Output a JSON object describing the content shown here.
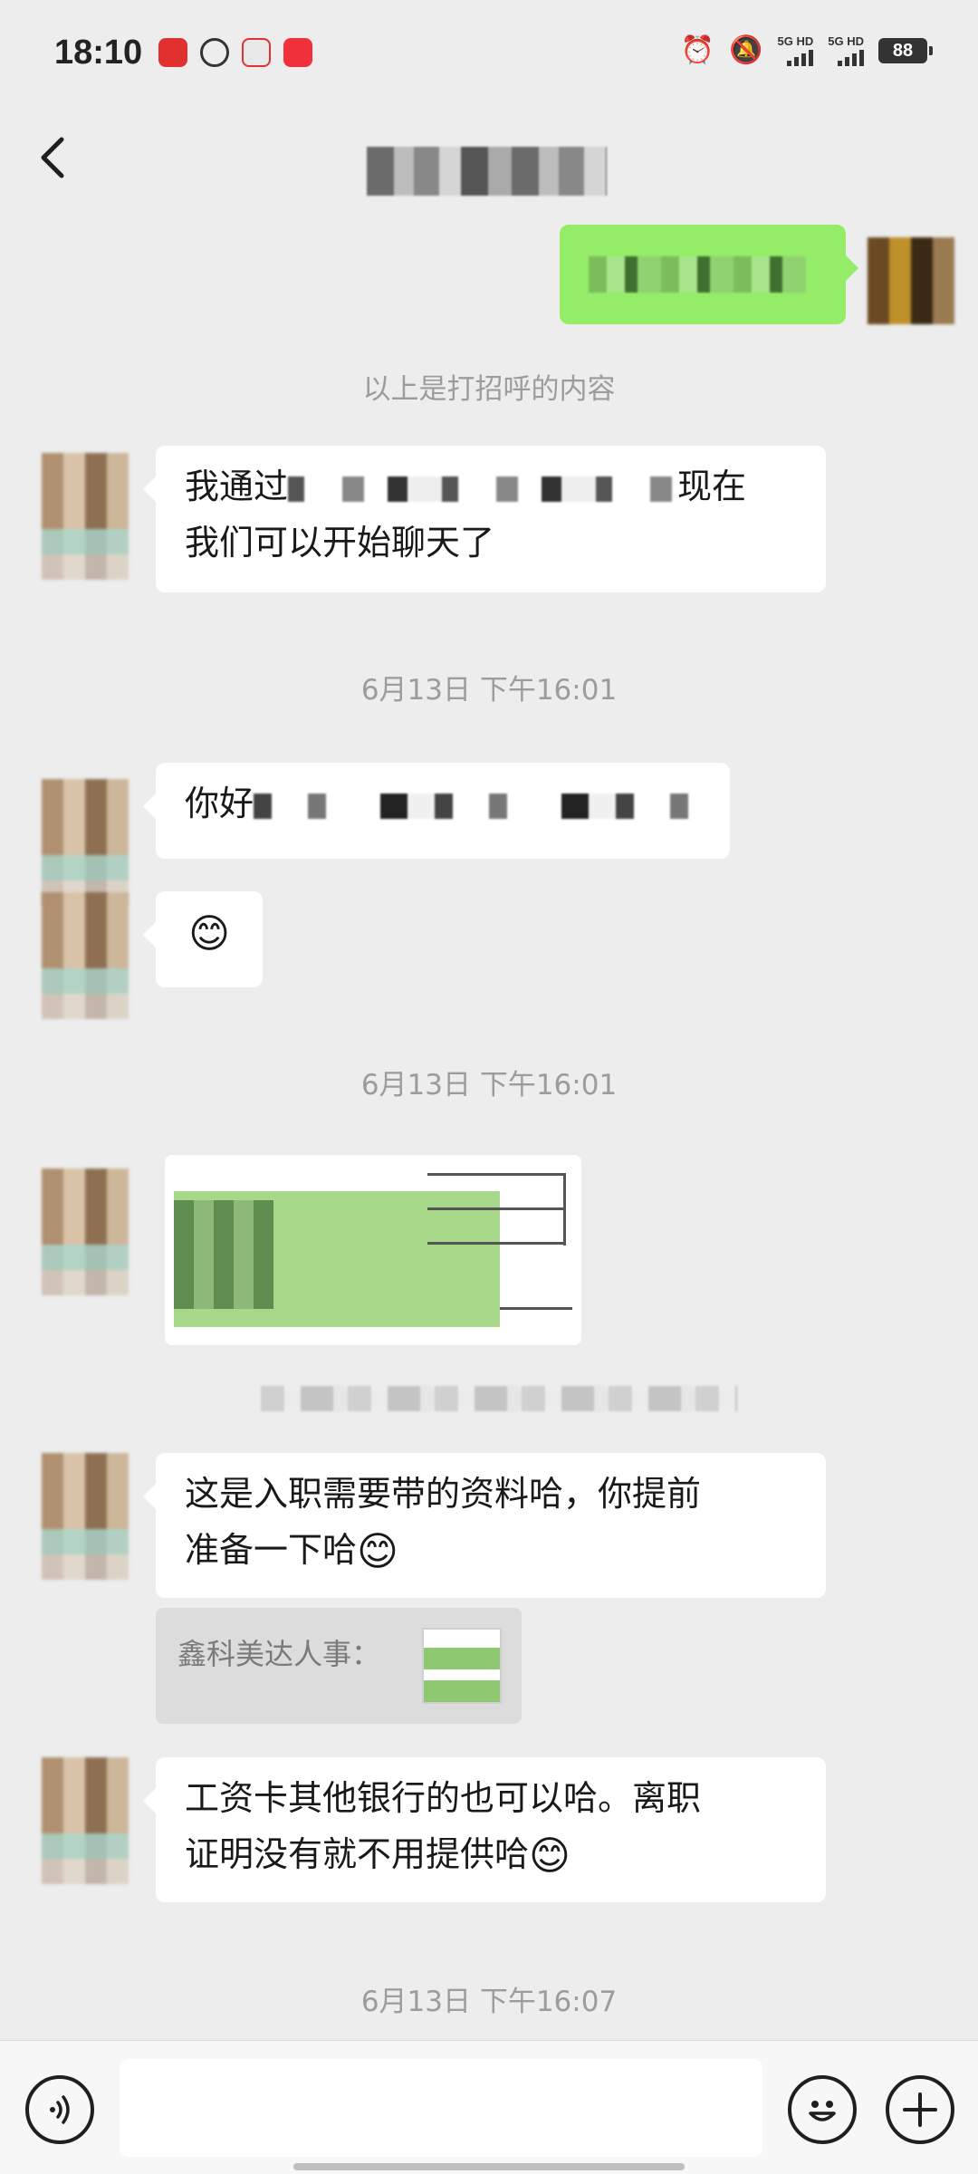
{
  "status_bar": {
    "time": "18:10",
    "signal_1_label": "5G HD",
    "signal_2_label": "5G HD",
    "battery": "88"
  },
  "chat": {
    "greeting_notice": "以上是打招呼的内容",
    "msg_1_prefix": "我通过",
    "msg_1_mid": "现在",
    "msg_1_line2": "我们可以开始聊天了",
    "timestamp_1": "6月13日 下午16:01",
    "msg_2_prefix": "你好",
    "msg_3_emoji": "😊",
    "timestamp_2": "6月13日 下午16:01",
    "msg_5_line1": "这是入职需要带的资料哈，你提前",
    "msg_5_line2": "准备一下哈",
    "msg_5_emoji": "😊",
    "quote_sender": "鑫科美达人事：",
    "msg_6_line1": "工资卡其他银行的也可以哈。离职",
    "msg_6_line2": "证明没有就不用提供哈",
    "msg_6_emoji": "😊",
    "timestamp_3": "6月13日 下午16:07"
  },
  "colors": {
    "background": "#ededed",
    "self_bubble": "#95ec69",
    "other_bubble": "#ffffff",
    "system_text": "#9c9c9c"
  },
  "icons": {
    "back": "chevron-left-icon",
    "voice": "voice-icon",
    "emoji": "smiley-icon",
    "plus": "plus-icon"
  }
}
